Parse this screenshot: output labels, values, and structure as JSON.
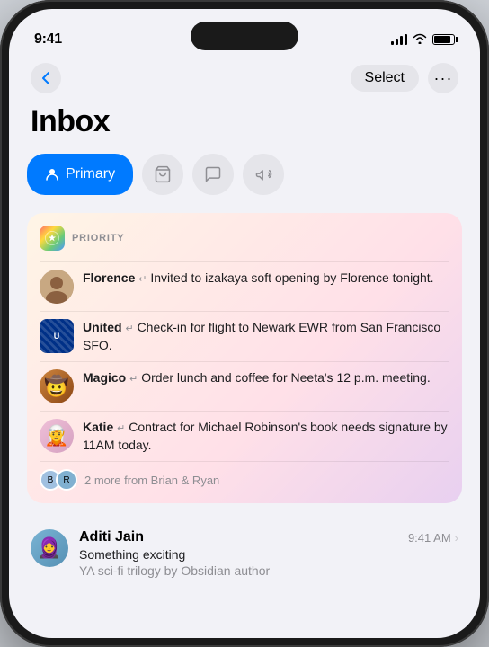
{
  "phone": {
    "time": "9:41",
    "dynamic_island": true
  },
  "nav": {
    "back_label": "‹",
    "select_label": "Select",
    "more_label": "···"
  },
  "header": {
    "title": "Inbox"
  },
  "tabs": [
    {
      "id": "primary",
      "label": "Primary",
      "icon": "👤",
      "active": true
    },
    {
      "id": "shopping",
      "label": "Shopping",
      "icon": "🛒",
      "active": false
    },
    {
      "id": "messages",
      "label": "Messages",
      "icon": "💬",
      "active": false
    },
    {
      "id": "promotions",
      "label": "Promotions",
      "icon": "📣",
      "active": false
    }
  ],
  "priority_section": {
    "label": "PRIORITY",
    "items": [
      {
        "sender": "Florence",
        "preview": "Invited to izakaya soft opening by Florence tonight.",
        "avatar_emoji": "👩",
        "avatar_color": "#c8a882"
      },
      {
        "sender": "United",
        "preview": "Check-in for flight to Newark EWR from San Francisco SFO.",
        "avatar_type": "logo",
        "avatar_color": "#003087"
      },
      {
        "sender": "Magico",
        "preview": "Order lunch and coffee for Neeta's 12 p.m. meeting.",
        "avatar_emoji": "🤠",
        "avatar_color": "#8B4513"
      },
      {
        "sender": "Katie",
        "preview": "Contract for Michael Robinson's book needs signature by 11AM today.",
        "avatar_emoji": "🧝",
        "avatar_color": "#e8b4d0"
      }
    ],
    "more_from": "2 more from Brian & Ryan"
  },
  "email_list": [
    {
      "sender": "Aditi Jain",
      "subject": "Something exciting",
      "preview": "YA sci-fi trilogy by Obsidian author",
      "time": "9:41 AM",
      "avatar_emoji": "🧕",
      "avatar_color": "#7ab4d4"
    }
  ]
}
